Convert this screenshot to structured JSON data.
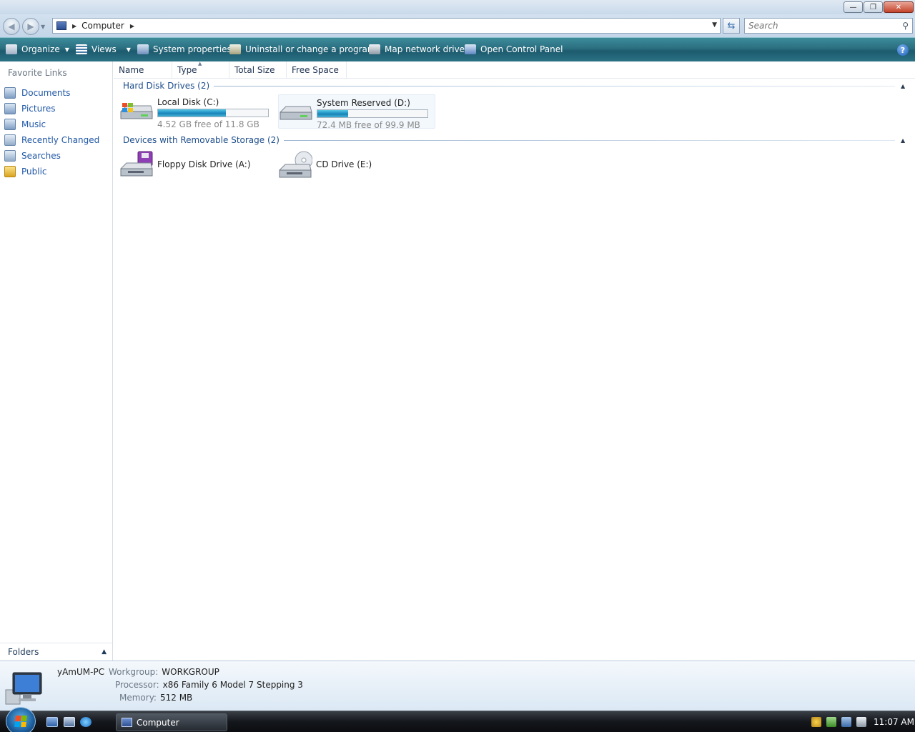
{
  "window": {
    "minimize": "—",
    "maximize": "❐",
    "close": "✕"
  },
  "address": {
    "crumbs": [
      "Computer"
    ],
    "search_placeholder": "Search"
  },
  "toolbar": {
    "organize": "Organize",
    "views": "Views",
    "system_properties": "System properties",
    "uninstall": "Uninstall or change a program",
    "map_drive": "Map network drive",
    "control_panel": "Open Control Panel",
    "help": "?"
  },
  "nav": {
    "title": "Favorite Links",
    "items": [
      {
        "label": "Documents",
        "icon": "documents-icon"
      },
      {
        "label": "Pictures",
        "icon": "pictures-icon"
      },
      {
        "label": "Music",
        "icon": "music-icon"
      },
      {
        "label": "Recently Changed",
        "icon": "recently-changed-icon"
      },
      {
        "label": "Searches",
        "icon": "searches-icon"
      },
      {
        "label": "Public",
        "icon": "public-folder-icon"
      }
    ],
    "folders": "Folders"
  },
  "columns": [
    "Name",
    "Type",
    "Total Size",
    "Free Space"
  ],
  "groups": {
    "hard_disks": {
      "label": "Hard Disk Drives (2)",
      "drives": [
        {
          "name": "Local Disk (C:)",
          "free": "4.52 GB free of 11.8 GB",
          "used_fraction": 0.62
        },
        {
          "name": "System Reserved (D:)",
          "free": "72.4 MB free of 99.9 MB",
          "used_fraction": 0.28
        }
      ]
    },
    "removable": {
      "label": "Devices with Removable Storage (2)",
      "drives": [
        {
          "name": "Floppy Disk Drive (A:)"
        },
        {
          "name": "CD Drive (E:)"
        }
      ]
    }
  },
  "details": {
    "computer_name": "yAmUM-PC",
    "workgroup_label": "Workgroup:",
    "workgroup": "WORKGROUP",
    "processor_label": "Processor:",
    "processor": "x86 Family 6 Model 7 Stepping 3",
    "memory_label": "Memory:",
    "memory": "512 MB"
  },
  "taskbar": {
    "window_button": "Computer",
    "clock": "11:07 AM"
  },
  "colors": {
    "command_bar": "#2a6e80",
    "link_blue": "#1f57a6",
    "usage_bar": "#1b8cc1"
  }
}
